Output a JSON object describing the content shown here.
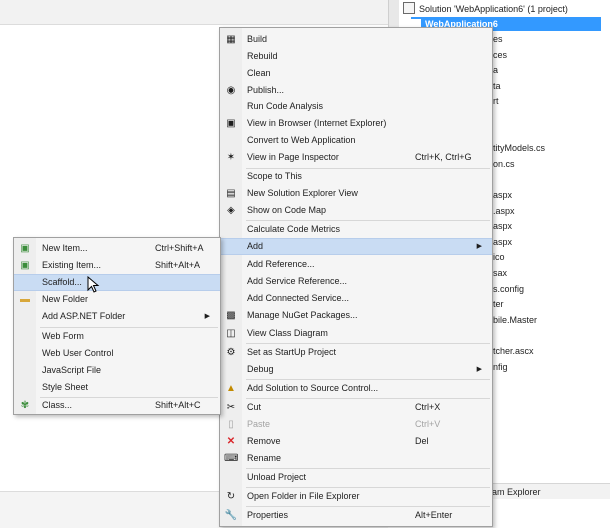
{
  "solution_explorer": {
    "root": "Solution 'WebApplication6' (1 project)",
    "project": "WebApplication6",
    "items": [
      "es",
      "ces",
      "a",
      "ta",
      "rt",
      "",
      "",
      "tityModels.cs",
      "on.cs",
      "",
      "aspx",
      ".aspx",
      "aspx",
      "aspx",
      "ico",
      "sax",
      "s.config",
      "ter",
      "bile.Master",
      "",
      "tcher.ascx",
      "nfig"
    ],
    "footer": "eam Explorer"
  },
  "main_menu": {
    "build": "Build",
    "rebuild": "Rebuild",
    "clean": "Clean",
    "publish": "Publish...",
    "run_code_analysis": "Run Code Analysis",
    "view_in_browser": "View in Browser (Internet Explorer)",
    "convert": "Convert to Web Application",
    "view_page_inspector": "View in Page Inspector",
    "view_page_inspector_sc": "Ctrl+K, Ctrl+G",
    "scope_to_this": "Scope to This",
    "new_solution_explorer_view": "New Solution Explorer View",
    "show_on_code_map": "Show on Code Map",
    "calculate_code_metrics": "Calculate Code Metrics",
    "add": "Add",
    "add_reference": "Add Reference...",
    "add_service_reference": "Add Service Reference...",
    "add_connected_service": "Add Connected Service...",
    "manage_nuget": "Manage NuGet Packages...",
    "view_class_diagram": "View Class Diagram",
    "set_startup": "Set as StartUp Project",
    "debug": "Debug",
    "add_to_source_control": "Add Solution to Source Control...",
    "cut": "Cut",
    "cut_sc": "Ctrl+X",
    "paste": "Paste",
    "paste_sc": "Ctrl+V",
    "remove": "Remove",
    "remove_sc": "Del",
    "rename": "Rename",
    "unload_project": "Unload Project",
    "open_folder": "Open Folder in File Explorer",
    "properties": "Properties",
    "properties_sc": "Alt+Enter"
  },
  "add_submenu": {
    "new_item": "New Item...",
    "new_item_sc": "Ctrl+Shift+A",
    "existing_item": "Existing Item...",
    "existing_item_sc": "Shift+Alt+A",
    "scaffold": "Scaffold...",
    "new_folder": "New Folder",
    "add_aspnet_folder": "Add ASP.NET Folder",
    "web_form": "Web Form",
    "web_user_control": "Web User Control",
    "javascript_file": "JavaScript File",
    "style_sheet": "Style Sheet",
    "class": "Class...",
    "class_sc": "Shift+Alt+C"
  },
  "icons": {
    "build": "build-icon",
    "publish": "globe-icon",
    "view_in_browser": "browser-icon",
    "page_inspector": "inspector-icon",
    "new_solution_view": "window-icon",
    "code_map": "code-map-icon",
    "nuget": "package-icon",
    "class_diagram": "diagram-icon",
    "set_startup": "gear-icon",
    "source_control": "source-control-icon",
    "cut": "scissors-icon",
    "paste": "clipboard-icon",
    "remove": "x-icon",
    "rename": "rename-icon",
    "open_folder": "open-folder-icon",
    "properties": "wrench-icon"
  },
  "colors": {
    "highlight": "#c9dcf3",
    "selection": "#3399ff",
    "remove_red": "#d9262b"
  }
}
